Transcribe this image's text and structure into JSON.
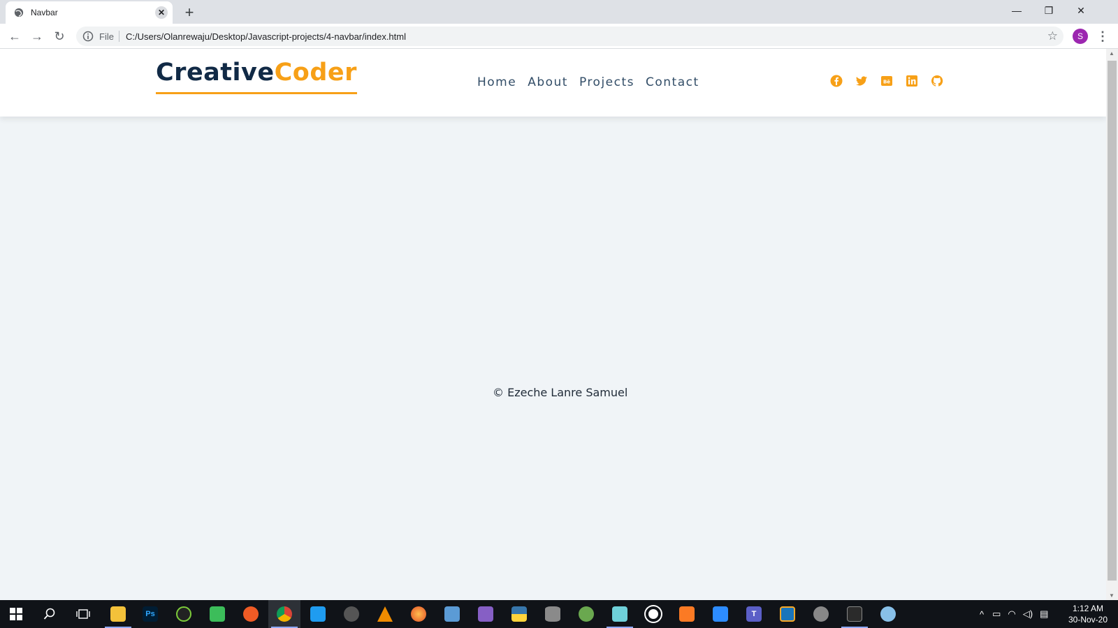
{
  "browser": {
    "tab_title": "Navbar",
    "scheme_label": "File",
    "url": "C:/Users/Olanrewaju/Desktop/Javascript-projects/4-navbar/index.html",
    "profile_initial": "S"
  },
  "site": {
    "logo_part1": "Creative",
    "logo_part2": "Coder",
    "nav_links": [
      "Home",
      "About",
      "Projects",
      "Contact"
    ],
    "social_icons": [
      "facebook-icon",
      "twitter-icon",
      "behance-icon",
      "linkedin-icon",
      "github-icon"
    ],
    "footer": "© Ezeche Lanre Samuel",
    "colors": {
      "accent": "#f7a017",
      "logo_dark": "#112a46",
      "nav_text": "#324d67",
      "background": "#f0f4f7"
    }
  },
  "taskbar": {
    "apps": [
      "file-explorer",
      "photoshop",
      "inkscape",
      "trello",
      "postman",
      "chrome",
      "vscode",
      "obs",
      "vlc",
      "firefox",
      "virtualbox",
      "visual-studio",
      "python",
      "database",
      "chameleon",
      "notepad",
      "unity",
      "xampp",
      "zoom",
      "teams",
      "fileZilla",
      "davinci",
      "terminal",
      "paint"
    ],
    "clock_time": "1:12 AM",
    "clock_date": "30-Nov-20"
  }
}
